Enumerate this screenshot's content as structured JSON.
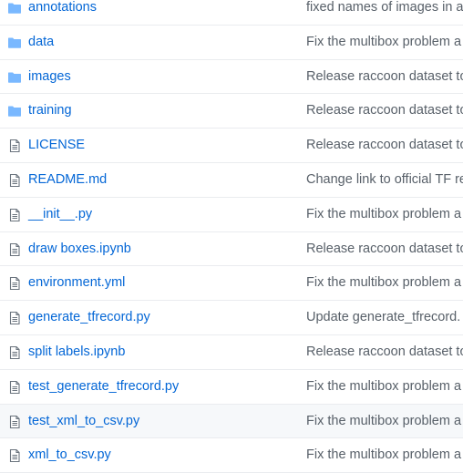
{
  "files": [
    {
      "type": "dir",
      "icon": "folder-icon",
      "name": "annotations",
      "message": "fixed names of images in a"
    },
    {
      "type": "dir",
      "icon": "folder-icon",
      "name": "data",
      "message": "Fix the multibox problem a"
    },
    {
      "type": "dir",
      "icon": "folder-icon",
      "name": "images",
      "message": "Release raccoon dataset to"
    },
    {
      "type": "dir",
      "icon": "folder-icon",
      "name": "training",
      "message": "Release raccoon dataset to"
    },
    {
      "type": "file",
      "icon": "file-icon",
      "name": "LICENSE",
      "message": "Release raccoon dataset to"
    },
    {
      "type": "file",
      "icon": "file-icon",
      "name": "README.md",
      "message": "Change link to official TF re"
    },
    {
      "type": "file",
      "icon": "file-icon",
      "name": "__init__.py",
      "message": "Fix the multibox problem a"
    },
    {
      "type": "file",
      "icon": "file-icon",
      "name": "draw boxes.ipynb",
      "message": "Release raccoon dataset to"
    },
    {
      "type": "file",
      "icon": "file-icon",
      "name": "environment.yml",
      "message": "Fix the multibox problem a"
    },
    {
      "type": "file",
      "icon": "file-icon",
      "name": "generate_tfrecord.py",
      "message": "Update generate_tfrecord."
    },
    {
      "type": "file",
      "icon": "file-icon",
      "name": "split labels.ipynb",
      "message": "Release raccoon dataset to"
    },
    {
      "type": "file",
      "icon": "file-icon",
      "name": "test_generate_tfrecord.py",
      "message": "Fix the multibox problem a"
    },
    {
      "type": "file",
      "icon": "file-icon",
      "name": "test_xml_to_csv.py",
      "message": "Fix the multibox problem a",
      "highlighted": true
    },
    {
      "type": "file",
      "icon": "file-icon",
      "name": "xml_to_csv.py",
      "message": "Fix the multibox problem a"
    }
  ],
  "colors": {
    "link": "#0366d6",
    "message": "#586069",
    "folder": "#79b8ff",
    "file_icon": "#6a737d",
    "row_border": "#eaecef",
    "row_highlight": "#f6f8fa"
  }
}
